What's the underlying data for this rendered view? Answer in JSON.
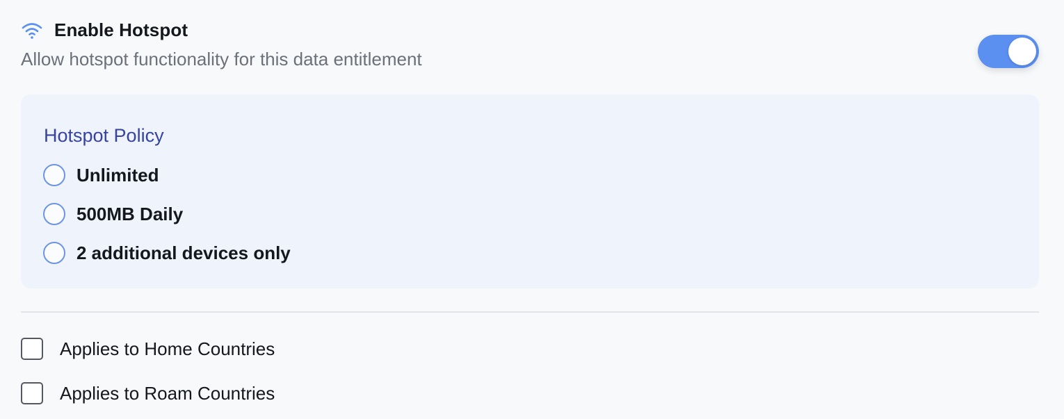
{
  "hotspot": {
    "icon": "wifi-icon",
    "title": "Enable Hotspot",
    "subtitle": "Allow hotspot functionality for this data entitlement",
    "enabled": true,
    "accent_color": "#5b8ff0"
  },
  "policy": {
    "title": "Hotspot Policy",
    "options": [
      {
        "label": "Unlimited",
        "selected": false
      },
      {
        "label": "500MB Daily",
        "selected": false
      },
      {
        "label": "2 additional devices only",
        "selected": false
      }
    ]
  },
  "applies": [
    {
      "label": "Applies to Home Countries",
      "checked": false
    },
    {
      "label": "Applies to Roam Countries",
      "checked": false
    }
  ]
}
